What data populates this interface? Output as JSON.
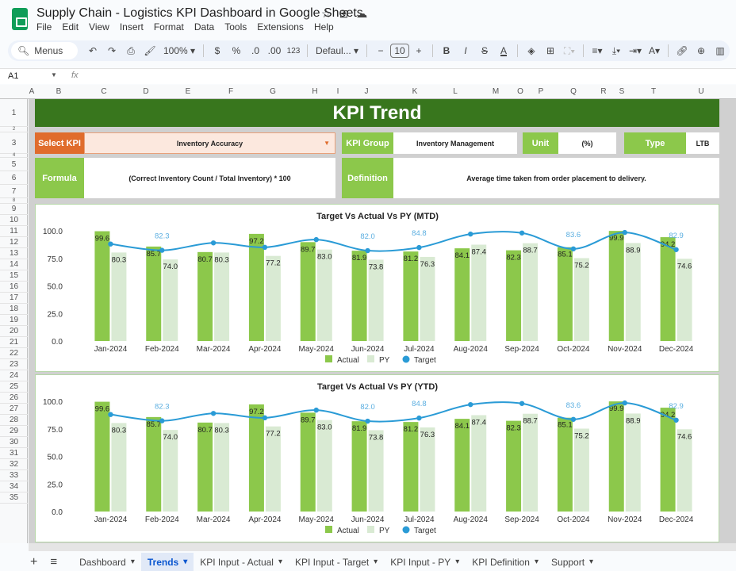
{
  "app": {
    "doc_title": "Supply Chain - Logistics KPI Dashboard in Google Sheets",
    "title_icons": [
      "star-icon",
      "move-to-folder-icon",
      "cloud-saved-icon"
    ],
    "menu": [
      "File",
      "Edit",
      "View",
      "Insert",
      "Format",
      "Data",
      "Tools",
      "Extensions",
      "Help"
    ]
  },
  "toolbar": {
    "search_label": "Menus",
    "zoom": "100%",
    "currency": "$",
    "percent": "%",
    "decrease_decimal": ".0",
    "increase_decimal": ".00",
    "number_format": "123",
    "font": "Defaul...",
    "font_size": "10",
    "minus": "−",
    "plus": "+",
    "bold": "B",
    "italic": "I",
    "strike": "S",
    "text_color": "A"
  },
  "formula_bar": {
    "cell_ref": "A1",
    "fx": "fx",
    "value": ""
  },
  "columns": [
    "A",
    "B",
    "C",
    "D",
    "E",
    "F",
    "G",
    "H",
    "I",
    "J",
    "K",
    "L",
    "M",
    "O",
    "P",
    "Q",
    "R",
    "S",
    "T",
    "U"
  ],
  "rows": [
    "1",
    "2",
    "3",
    "4",
    "5",
    "6",
    "7",
    "8",
    "9",
    "10",
    "11",
    "12",
    "13",
    "14",
    "15",
    "16",
    "17",
    "18",
    "19",
    "20",
    "21",
    "22",
    "23",
    "24",
    "25",
    "26",
    "27",
    "28",
    "29",
    "30",
    "31",
    "32",
    "33",
    "34",
    "35"
  ],
  "dashboard": {
    "title": "KPI Trend",
    "select_kpi_label": "Select KPI",
    "select_kpi_value": "Inventory Accuracy",
    "kpi_group_label": "KPI Group",
    "kpi_group_value": "Inventory Management",
    "unit_label": "Unit",
    "unit_value": "(%)",
    "type_label": "Type",
    "type_value": "LTB",
    "formula_label": "Formula",
    "formula_value": "(Correct Inventory Count / Total Inventory) * 100",
    "definition_label": "Definition",
    "definition_value": "Average time taken from order placement to delivery.",
    "colors": {
      "banner": "#38761d",
      "select_label": "#e06c2c",
      "select_bg": "#fce8de",
      "label_green": "#8cc84b",
      "actual": "#8cc84b",
      "py": "#d9ead3",
      "target": "#2a9bd6"
    }
  },
  "chart_data": [
    {
      "type": "bar",
      "title": "Target Vs Actual Vs PY (MTD)",
      "categories": [
        "Jan-2024",
        "Feb-2024",
        "Mar-2024",
        "Apr-2024",
        "May-2024",
        "Jun-2024",
        "Jul-2024",
        "Aug-2024",
        "Sep-2024",
        "Oct-2024",
        "Nov-2024",
        "Dec-2024"
      ],
      "series": [
        {
          "name": "Actual",
          "type": "bar",
          "values": [
            99.6,
            85.7,
            80.7,
            97.2,
            89.7,
            81.9,
            81.2,
            84.1,
            82.3,
            85.1,
            99.9,
            94.2
          ]
        },
        {
          "name": "PY",
          "type": "bar",
          "values": [
            80.3,
            74.0,
            80.3,
            77.2,
            83.0,
            73.8,
            76.3,
            87.4,
            88.7,
            75.2,
            88.9,
            74.6
          ]
        },
        {
          "name": "Target",
          "type": "line",
          "values": [
            88.0,
            82.3,
            89.0,
            85.0,
            92.0,
            82.0,
            84.8,
            97.0,
            98.0,
            83.6,
            98.5,
            82.9
          ],
          "labels": [
            "",
            "82.3",
            "",
            "",
            "",
            "82.0",
            "84.8",
            "",
            "",
            "83.6",
            "",
            "82.9"
          ]
        }
      ],
      "yticks": [
        "0.0",
        "25.0",
        "50.0",
        "75.0",
        "100.0"
      ],
      "ylim": [
        0,
        100
      ],
      "legend": [
        "Actual",
        "PY",
        "Target"
      ],
      "legend_position": "bottom"
    },
    {
      "type": "bar",
      "title": "Target Vs Actual Vs PY (YTD)",
      "categories": [
        "Jan-2024",
        "Feb-2024",
        "Mar-2024",
        "Apr-2024",
        "May-2024",
        "Jun-2024",
        "Jul-2024",
        "Aug-2024",
        "Sep-2024",
        "Oct-2024",
        "Nov-2024",
        "Dec-2024"
      ],
      "series": [
        {
          "name": "Actual",
          "type": "bar",
          "values": [
            99.6,
            85.7,
            80.7,
            97.2,
            89.7,
            81.9,
            81.2,
            84.1,
            82.3,
            85.1,
            99.9,
            94.2
          ]
        },
        {
          "name": "PY",
          "type": "bar",
          "values": [
            80.3,
            74.0,
            80.3,
            77.2,
            83.0,
            73.8,
            76.3,
            87.4,
            88.7,
            75.2,
            88.9,
            74.6
          ]
        },
        {
          "name": "Target",
          "type": "line",
          "values": [
            88.0,
            82.3,
            89.0,
            85.0,
            92.0,
            82.0,
            84.8,
            97.0,
            98.0,
            83.6,
            98.5,
            82.9
          ],
          "labels": [
            "",
            "82.3",
            "",
            "",
            "",
            "82.0",
            "84.8",
            "",
            "",
            "83.6",
            "",
            "82.9"
          ]
        }
      ],
      "yticks": [
        "0.0",
        "25.0",
        "50.0",
        "75.0",
        "100.0"
      ],
      "ylim": [
        0,
        100
      ],
      "legend": [
        "Actual",
        "PY",
        "Target"
      ],
      "legend_position": "bottom"
    }
  ],
  "sheet_tabs": [
    {
      "label": "Dashboard",
      "active": false
    },
    {
      "label": "Trends",
      "active": true
    },
    {
      "label": "KPI Input - Actual",
      "active": false
    },
    {
      "label": "KPI Input - Target",
      "active": false
    },
    {
      "label": "KPI Input - PY",
      "active": false
    },
    {
      "label": "KPI Definition",
      "active": false
    },
    {
      "label": "Support",
      "active": false
    }
  ]
}
